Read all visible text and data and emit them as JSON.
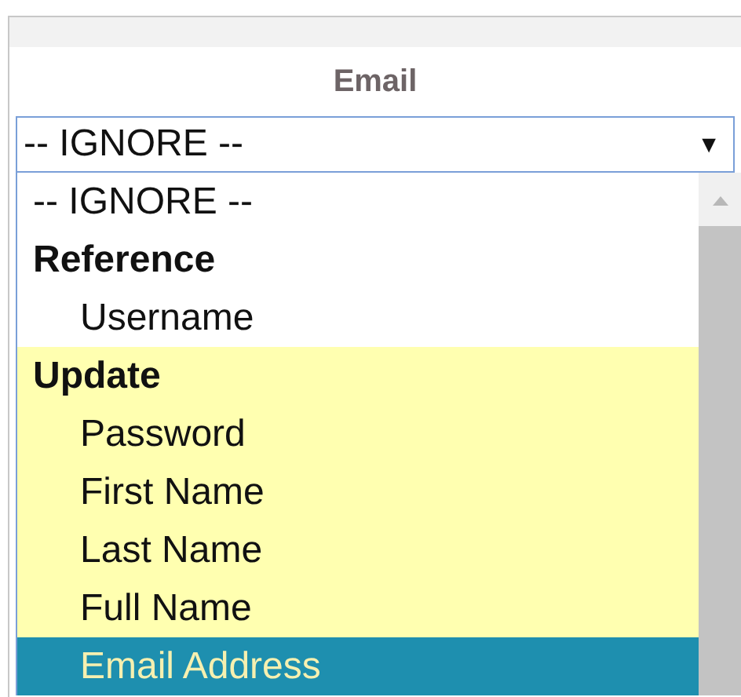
{
  "column": {
    "header": "Email"
  },
  "select": {
    "value": "-- IGNORE --",
    "arrow": "▼"
  },
  "dropdown": {
    "options": [
      {
        "label": "-- IGNORE --",
        "selected": false
      }
    ],
    "groups": [
      {
        "label": "Reference",
        "highlighted": false,
        "options": [
          {
            "label": "Username",
            "selected": false
          }
        ]
      },
      {
        "label": "Update",
        "highlighted": true,
        "options": [
          {
            "label": "Password",
            "selected": false
          },
          {
            "label": "First Name",
            "selected": false
          },
          {
            "label": "Last Name",
            "selected": false
          },
          {
            "label": "Full Name",
            "selected": false
          },
          {
            "label": "Email Address",
            "selected": true
          }
        ]
      }
    ]
  }
}
